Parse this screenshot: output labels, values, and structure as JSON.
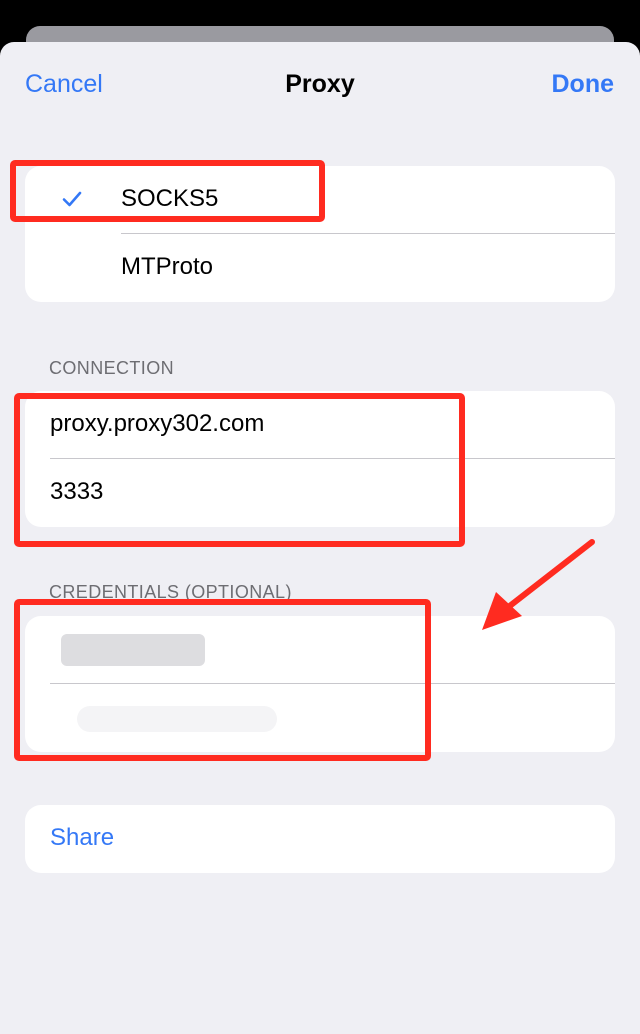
{
  "nav": {
    "cancel": "Cancel",
    "title": "Proxy",
    "done": "Done"
  },
  "proxy_types": [
    {
      "label": "SOCKS5",
      "selected": true
    },
    {
      "label": "MTProto",
      "selected": false
    }
  ],
  "connection": {
    "header": "CONNECTION",
    "server": "proxy.proxy302.com",
    "port": "3333"
  },
  "credentials": {
    "header": "CREDENTIALS (OPTIONAL)"
  },
  "share": {
    "label": "Share"
  },
  "colors": {
    "accent": "#3478f6",
    "annotation": "#ff2b20",
    "background": "#efeff4"
  },
  "icons": {
    "selected_mark": "checkmark-icon",
    "annotation_pointer": "red-arrow-icon"
  }
}
